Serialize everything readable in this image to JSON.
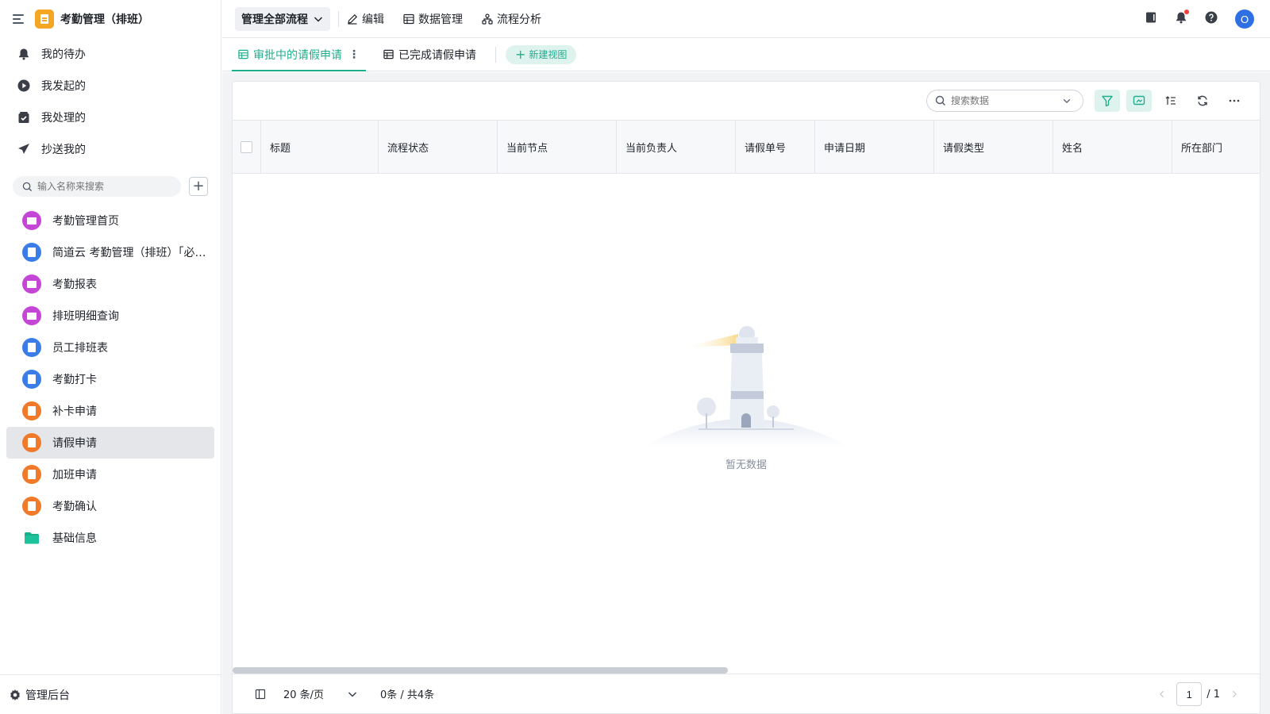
{
  "app": {
    "title": "考勤管理（排班）"
  },
  "nav": {
    "items": [
      {
        "label": "我的待办",
        "icon": "bell-icon"
      },
      {
        "label": "我发起的",
        "icon": "play-circle-icon"
      },
      {
        "label": "我处理的",
        "icon": "check-box-icon"
      },
      {
        "label": "抄送我的",
        "icon": "send-icon"
      }
    ]
  },
  "sidebar_search": {
    "placeholder": "输入名称来搜索"
  },
  "forms": [
    {
      "label": "考勤管理首页",
      "color": "purple",
      "icon": "dashboard-icon"
    },
    {
      "label": "简道云 考勤管理（排班）「必看…",
      "color": "blue",
      "icon": "document-icon"
    },
    {
      "label": "考勤报表",
      "color": "purple",
      "icon": "dashboard-icon"
    },
    {
      "label": "排班明细查询",
      "color": "purple",
      "icon": "dashboard-icon"
    },
    {
      "label": "员工排班表",
      "color": "blue",
      "icon": "document-icon"
    },
    {
      "label": "考勤打卡",
      "color": "blue",
      "icon": "document-icon"
    },
    {
      "label": "补卡申请",
      "color": "orange",
      "icon": "flow-form-icon"
    },
    {
      "label": "请假申请",
      "color": "orange",
      "icon": "flow-form-icon",
      "active": true
    },
    {
      "label": "加班申请",
      "color": "orange",
      "icon": "flow-form-icon"
    },
    {
      "label": "考勤确认",
      "color": "orange",
      "icon": "flow-form-icon"
    },
    {
      "label": "基础信息",
      "color": "folder",
      "icon": "folder-icon"
    }
  ],
  "footer": {
    "admin_label": "管理后台"
  },
  "toolbar": {
    "process_select": "管理全部流程",
    "edit": "编辑",
    "data_manage": "数据管理",
    "flow_analysis": "流程分析",
    "avatar": "O"
  },
  "tabs": {
    "active": "审批中的请假申请",
    "completed": "已完成请假申请",
    "new_view": "新建视图"
  },
  "data_search": {
    "placeholder": "搜索数据"
  },
  "table": {
    "columns": [
      "标题",
      "流程状态",
      "当前节点",
      "当前负责人",
      "请假单号",
      "申请日期",
      "请假类型",
      "姓名",
      "所在部门"
    ]
  },
  "empty": {
    "text": "暂无数据"
  },
  "pager": {
    "page_size": "20 条/页",
    "count": "0条 / 共4条",
    "current_page": "1",
    "total_pages": "/ 1"
  },
  "colors": {
    "accent": "#1fae8e",
    "avatar": "#2f6fe4",
    "app_logo": "#f5a623"
  }
}
